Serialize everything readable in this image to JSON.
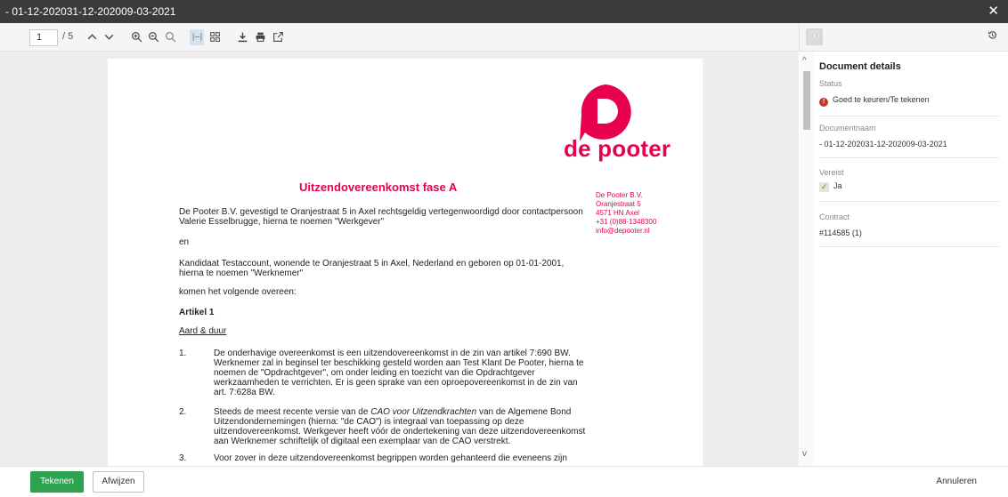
{
  "window": {
    "title": "- 01-12-202031-12-202009-03-2021",
    "close_glyph": "✕"
  },
  "toolbar": {
    "page_current": "1",
    "page_total": "/ 5",
    "icons": [
      "chevron-up-icon",
      "chevron-down-icon",
      "zoom-in-icon",
      "zoom-out-icon",
      "zoom-reset-icon",
      "fit-width-icon",
      "grid-view-icon",
      "download-icon",
      "print-icon",
      "open-external-icon"
    ]
  },
  "document": {
    "logo_text": "de pooter",
    "title": "Uitzendovereenkomst fase A",
    "address": [
      "De Pooter B.V.",
      "Oranjestraat 5",
      "4571 HN Axel",
      "+31 (0)88-1348300",
      "info@depooter.nl"
    ],
    "intro": [
      "De Pooter B.V. gevestigd te Oranjestraat 5 in Axel rechtsgeldig vertegenwoordigd door contactpersoon",
      "Valerie Esselbrugge, hierna te noemen \"Werkgever\""
    ],
    "and": "en",
    "candidate": [
      "Kandidaat Testaccount, wonende te Oranjestraat 5 in Axel, Nederland en geboren op 01-01-2001,",
      "hierna te noemen \"Werknemer\""
    ],
    "agree": "komen het volgende overeen:",
    "article": "Artikel 1",
    "section": "Aard & duur",
    "items": [
      {
        "num": "1.",
        "lines": [
          "De onderhavige overeenkomst is een uitzendovereenkomst in de zin van artikel 7:690 BW.",
          "Werknemer zal in beginsel ter beschikking gesteld worden aan Test Klant De Pooter, hierna te",
          "noemen de \"Opdrachtgever\", om onder leiding en toezicht van die Opdrachtgever",
          "werkzaamheden te verrichten. Er is geen sprake van een oproepovereenkomst in de zin van",
          "art. 7:628a BW."
        ]
      },
      {
        "num": "2.",
        "lines_pre": "Steeds de meest recente versie van de ",
        "lines_italic": "CAO voor Uitzendkrachten",
        "lines_post": " van de Algemene Bond",
        "lines": [
          "Uitzendondernemingen (hierna: \"de CAO\") is integraal van toepassing op deze",
          "uitzendovereenkomst. Werkgever heeft vóór de ondertekening van deze uitzendovereenkomst",
          "aan Werknemer schriftelijk of digitaal een exemplaar van de CAO verstrekt."
        ]
      },
      {
        "num": "3.",
        "lines": [
          "Voor zover in deze uitzendovereenkomst begrippen worden gehanteerd die eveneens zijn"
        ]
      }
    ]
  },
  "details": {
    "heading": "Document details",
    "status_label": "Status",
    "status_value": "Goed te keuren/Te tekenen",
    "status_icon": "!",
    "docname_label": "Documentnaam",
    "docname_value": "- 01-12-202031-12-202009-03-2021",
    "required_label": "Vereist",
    "required_value": "Ja",
    "contract_label": "Contract",
    "contract_value": "#114585 (1)"
  },
  "footer": {
    "sign": "Tekenen",
    "reject": "Afwijzen",
    "cancel": "Annuleren"
  },
  "colors": {
    "brand": "#e6004f",
    "sign_button": "#2ea34f",
    "titlebar": "#3a3b3d",
    "link": "#2f5f9a"
  }
}
